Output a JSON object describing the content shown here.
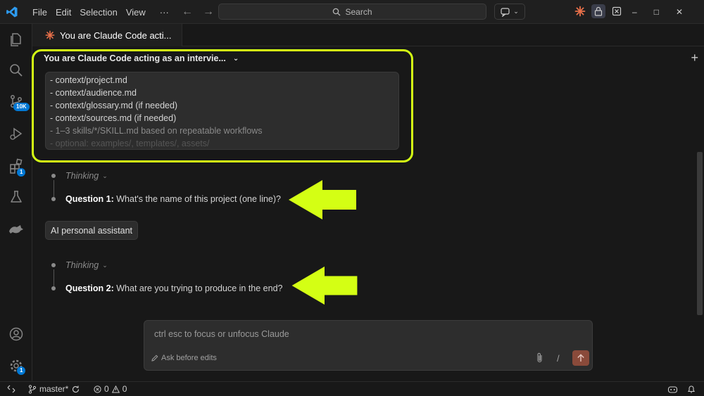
{
  "menu": [
    "File",
    "Edit",
    "Selection",
    "View",
    "···"
  ],
  "search": {
    "label": "Search"
  },
  "editor_tab": {
    "title": "You are Claude Code acti..."
  },
  "panel": {
    "session_title": "You are Claude Code acting as an intervie...",
    "file_items": [
      "- context/project.md",
      "- context/audience.md",
      "- context/glossary.md (if needed)",
      "- context/sources.md (if needed)",
      "- 1–3 skills/*/SKILL.md based on repeatable workflows",
      "- optional: examples/, templates/, assets/"
    ]
  },
  "messages": {
    "thinking_1": "Thinking",
    "q1_label": "Question 1:",
    "q1_text": " What's the name of this project (one line)?",
    "user_reply": "AI personal assistant",
    "thinking_2": "Thinking",
    "q2_label": "Question 2:",
    "q2_text": " What are you trying to produce in the end?"
  },
  "input": {
    "placeholder": "ctrl esc to focus or unfocus Claude",
    "mode_label": "Ask before edits",
    "slash": "/"
  },
  "activity_badges": {
    "source_control": "10K",
    "extensions": "1",
    "settings": "1"
  },
  "statusbar": {
    "branch": "master*",
    "errors": "0",
    "warnings": "0"
  },
  "colors": {
    "accent_highlight": "#d4ff14",
    "claude_orange": "#e8704a",
    "badge_blue": "#0078d4",
    "send_button": "#8a4a3a"
  }
}
